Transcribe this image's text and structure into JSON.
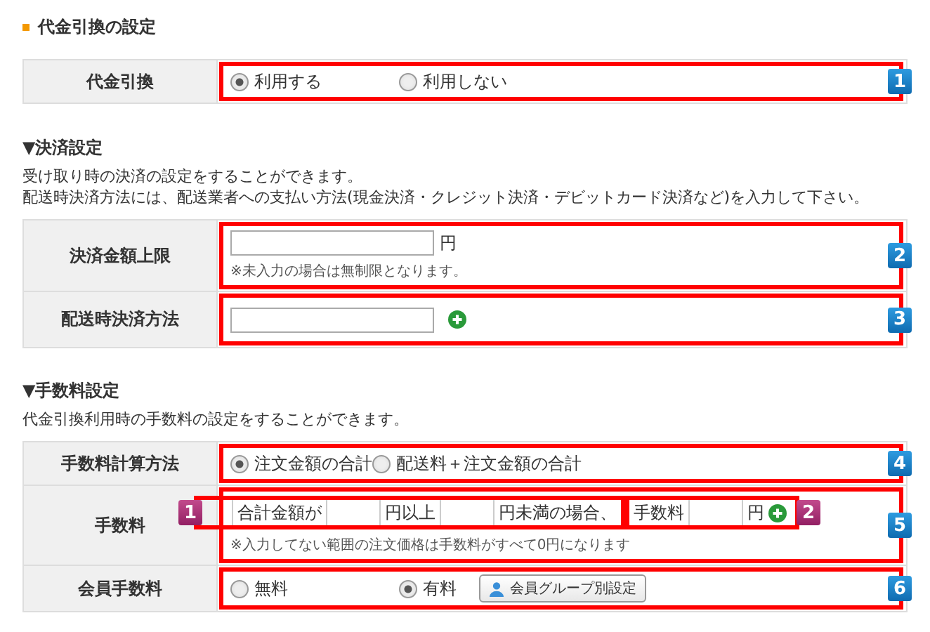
{
  "section_title": "代金引換の設定",
  "cod": {
    "label": "代金引換",
    "badge": "1",
    "options": [
      {
        "label": "利用する",
        "selected": true
      },
      {
        "label": "利用しない",
        "selected": false
      }
    ]
  },
  "payment": {
    "heading": "▼決済設定",
    "description": [
      "受け取り時の決済の設定をすることができます。",
      "配送時決済方法には、配送業者への支払い方法(現金決済・クレジット決済・デビットカード決済など)を入力して下さい。"
    ],
    "rows": [
      {
        "kind": "limit",
        "label": "決済金額上限",
        "badge": "2",
        "unit": "円",
        "note": "※未入力の場合は無制限となります。"
      },
      {
        "kind": "method",
        "label": "配送時決済方法",
        "badge": "3"
      }
    ]
  },
  "fee": {
    "heading": "▼手数料設定",
    "description": [
      "代金引換利用時の手数料の設定をすることができます。"
    ],
    "calc": {
      "label": "手数料計算方法",
      "badge": "4",
      "options": [
        {
          "label": "注文金額の合計",
          "selected": true
        },
        {
          "label": "配送料＋注文金額の合計",
          "selected": false
        }
      ]
    },
    "amount": {
      "label": "手数料",
      "badge": "5",
      "range_badge": "1",
      "range_parts": [
        "合計金額が",
        "円以上",
        "円未満の場合、"
      ],
      "fee_badge": "2",
      "fee_parts": [
        "手数料",
        "円"
      ],
      "note": "※入力してない範囲の注文価格は手数料がすべて0円になります"
    },
    "member": {
      "label": "会員手数料",
      "badge": "6",
      "options": [
        {
          "label": "無料",
          "selected": false
        },
        {
          "label": "有料",
          "selected": true
        }
      ],
      "button": "会員グループ別設定"
    }
  }
}
